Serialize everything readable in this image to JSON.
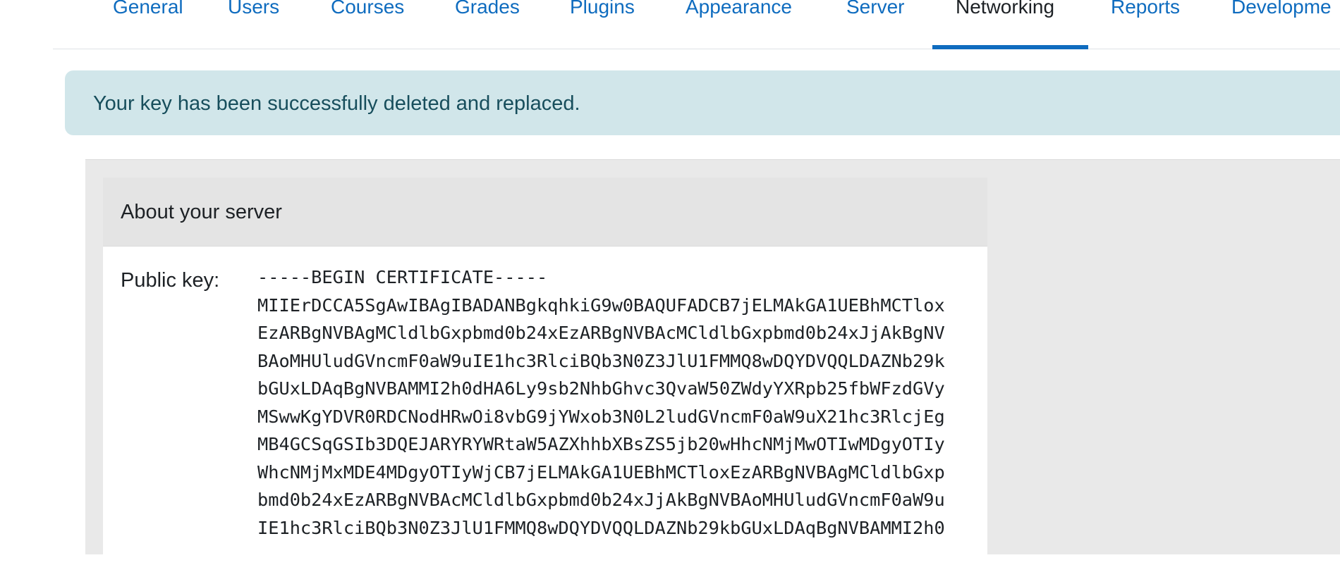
{
  "tabs": [
    {
      "label": "General"
    },
    {
      "label": "Users"
    },
    {
      "label": "Courses"
    },
    {
      "label": "Grades"
    },
    {
      "label": "Plugins"
    },
    {
      "label": "Appearance"
    },
    {
      "label": "Server"
    },
    {
      "label": "Networking"
    },
    {
      "label": "Reports"
    },
    {
      "label": "Developme"
    }
  ],
  "active_tab": "Networking",
  "alert": {
    "message": "Your key has been successfully deleted and replaced."
  },
  "server_card": {
    "title": "About your server",
    "public_key_label": "Public key:",
    "public_key_lines": [
      "-----BEGIN CERTIFICATE-----",
      "MIIErDCCA5SgAwIBAgIBADANBgkqhkiG9w0BAQUFADCB7jELMAkGA1UEBhMCTlox",
      "EzARBgNVBAgMCldlbGxpbmd0b24xEzARBgNVBAcMCldlbGxpbmd0b24xJjAkBgNV",
      "BAoMHUludGVncmF0aW9uIE1hc3RlciBQb3N0Z3JlU1FMMQ8wDQYDVQQLDAZNb29k",
      "bGUxLDAqBgNVBAMMI2h0dHA6Ly9sb2NhbGhvc3QvaW50ZWdyYXRpb25fbWFzdGVy",
      "MSwwKgYDVR0RDCNodHRwOi8vbG9jYWxob3N0L2ludGVncmF0aW9uX21hc3RlcjEg",
      "MB4GCSqGSIb3DQEJARYRYWRtaW5AZXhhbXBsZS5jb20wHhcNMjMwOTIwMDgyOTIy",
      "WhcNMjMxMDE4MDgyOTIyWjCB7jELMAkGA1UEBhMCTloxEzARBgNVBAgMCldlbGxp",
      "bmd0b24xEzARBgNVBAcMCldlbGxpbmd0b24xJjAkBgNVBAoMHUludGVncmF0aW9u",
      "IE1hc3RlciBQb3N0Z3JlU1FMMQ8wDQYDVQQLDAZNb29kbGUxLDAqBgNVBAMMI2h0"
    ]
  }
}
